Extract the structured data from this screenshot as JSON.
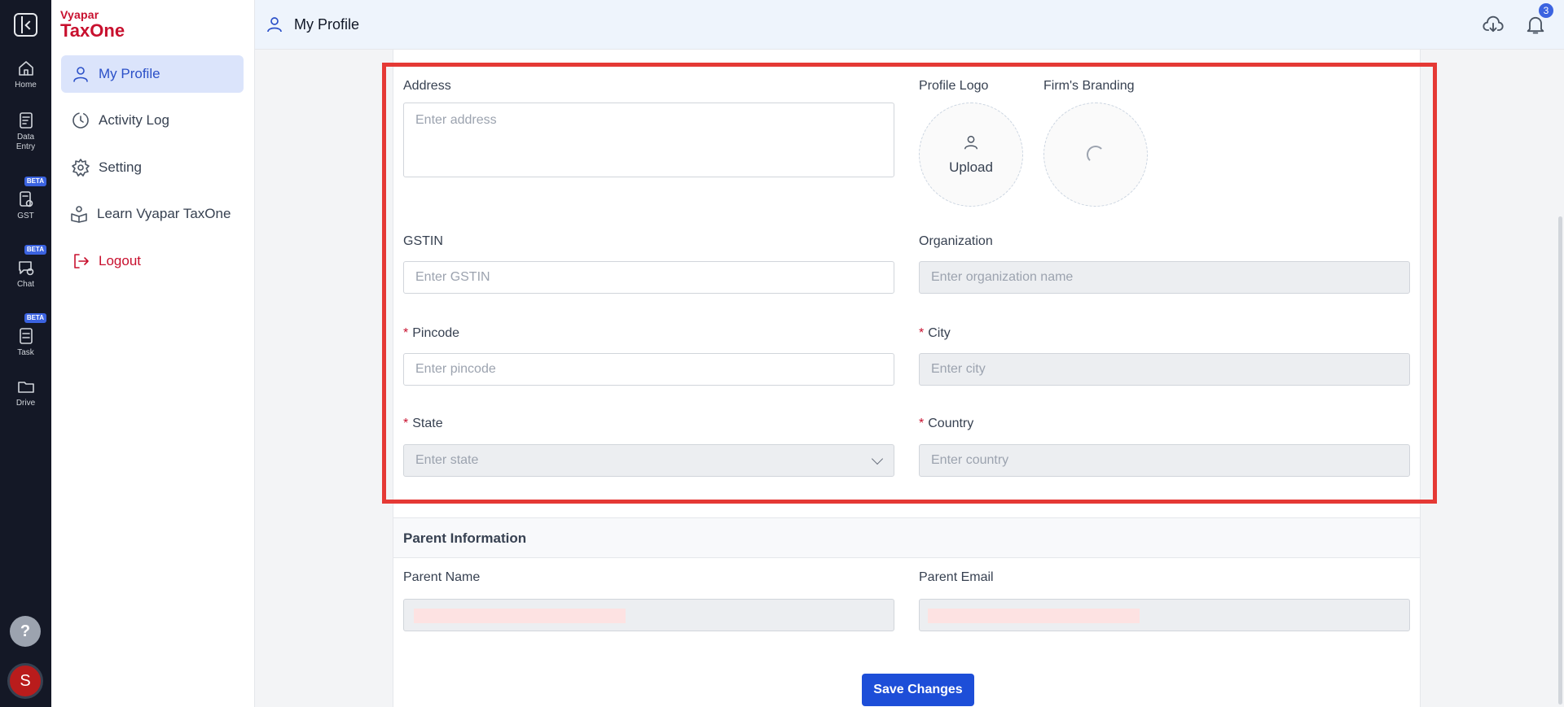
{
  "rail": {
    "items": [
      {
        "label": "Home"
      },
      {
        "label": "Data\nEntry"
      },
      {
        "label": "GST",
        "badge": "BETA"
      },
      {
        "label": "Chat",
        "badge": "BETA"
      },
      {
        "label": "Task",
        "badge": "BETA"
      },
      {
        "label": "Drive"
      }
    ],
    "help": "?",
    "avatar": "S"
  },
  "brand": {
    "top": "Vyapar",
    "bottom": "TaxOne"
  },
  "menu": {
    "items": [
      {
        "label": "My Profile",
        "icon": "user-icon",
        "active": true
      },
      {
        "label": "Activity Log",
        "icon": "clock-icon"
      },
      {
        "label": "Setting",
        "icon": "gear-icon"
      },
      {
        "label": "Learn Vyapar TaxOne",
        "icon": "learn-icon"
      },
      {
        "label": "Logout",
        "icon": "logout-icon"
      }
    ]
  },
  "header": {
    "title": "My Profile",
    "notification_count": "3"
  },
  "form": {
    "address": {
      "label": "Address",
      "placeholder": "Enter address"
    },
    "profile_logo": {
      "label": "Profile Logo",
      "action": "Upload"
    },
    "branding": {
      "label": "Firm's Branding"
    },
    "gstin": {
      "label": "GSTIN",
      "placeholder": "Enter GSTIN"
    },
    "organization": {
      "label": "Organization",
      "placeholder": "Enter organization name"
    },
    "pincode": {
      "label": "Pincode",
      "placeholder": "Enter pincode"
    },
    "city": {
      "label": "City",
      "placeholder": "Enter city"
    },
    "state": {
      "label": "State",
      "placeholder": "Enter state"
    },
    "country": {
      "label": "Country",
      "placeholder": "Enter country"
    },
    "required_mark": "*"
  },
  "parent": {
    "section_title": "Parent Information",
    "name_label": "Parent Name",
    "email_label": "Parent Email"
  },
  "actions": {
    "save": "Save Changes"
  },
  "colors": {
    "accent": "#1d4ed8",
    "brand": "#c8102e",
    "highlight": "#e53935"
  }
}
